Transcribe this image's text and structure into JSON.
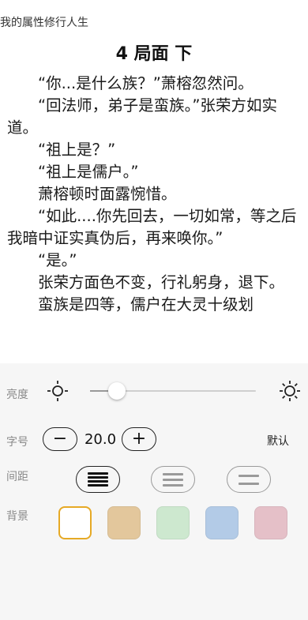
{
  "reader": {
    "book_title": "我的属性修行人生",
    "chapter_title": "4 局面 下",
    "paragraphs": [
      "“你...是什么族？”萧榕忽然问。",
      "“回法师，弟子是蛮族。”张荣方如实道。",
      "“祖上是？”",
      "“祖上是儒户。”",
      "萧榕顿时面露惋惜。",
      "“如此....你先回去，一切如常，等之后我暗中证实真伪后，再来唤你。”",
      "“是。”",
      "张荣方面色不变，行礼躬身，退下。",
      "蛮族是四等，儒户在大灵十级划"
    ]
  },
  "settings": {
    "brightness": {
      "label": "亮度",
      "level": 0.16,
      "low_icon": "sun-dim-icon",
      "high_icon": "sun-bright-icon"
    },
    "font_size": {
      "label": "字号",
      "value": "20.0",
      "minus": "−",
      "plus": "+",
      "default_label": "默认"
    },
    "spacing": {
      "label": "间距",
      "options": [
        "tight",
        "medium",
        "loose"
      ],
      "selected": 0
    },
    "background": {
      "label": "背景",
      "colors": [
        "#ffffff",
        "#e3c79c",
        "#cde8cf",
        "#b3cbe7",
        "#e5c0c8"
      ],
      "selected": 0,
      "selected_border": "#e6a925"
    }
  }
}
